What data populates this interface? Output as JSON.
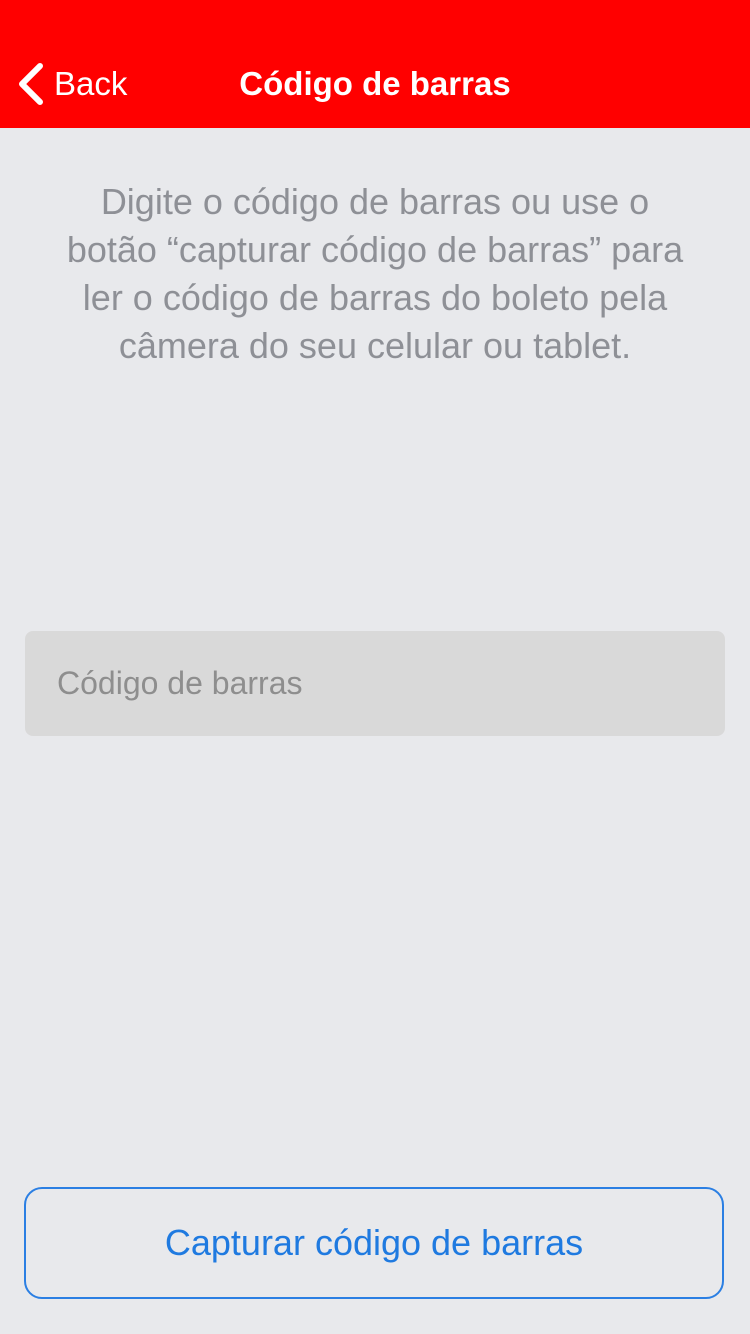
{
  "navbar": {
    "background_color": "#ff0000",
    "back_label": "Back",
    "back_icon": "chevron-left-icon",
    "title": "Código de barras"
  },
  "main": {
    "instructions": "Digite o código de barras ou use o botão “capturar código de barras” para ler o código de barras do boleto pela câmera do seu celular ou tablet.",
    "barcode_input": {
      "value": "",
      "placeholder": "Código de barras"
    },
    "capture_button_label": "Capturar código de barras",
    "accent_color": "#1f7ae0"
  }
}
